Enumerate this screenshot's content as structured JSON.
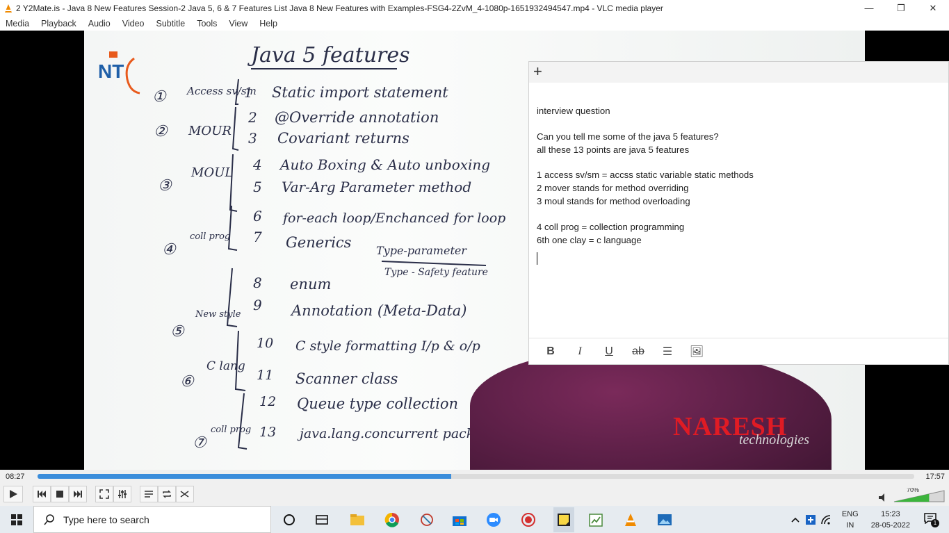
{
  "window": {
    "title": "2 Y2Mate.is - Java 8 New Features  Session-2  Java 5, 6 & 7 Features List  Java 8 New Features with Examples-FSG4-2ZvM_4-1080p-1651932494547.mp4 - VLC media player",
    "minimize": "—",
    "restore": "❐",
    "close": "✕"
  },
  "menu": [
    "Media",
    "Playback",
    "Audio",
    "Video",
    "Subtitle",
    "Tools",
    "View",
    "Help"
  ],
  "video": {
    "board_title": "Java 5 features",
    "logo_text": "NT",
    "brand_main": "NARESH",
    "brand_sub": "technologies",
    "groups": [
      {
        "num": "①",
        "label": "Access sv/sm"
      },
      {
        "num": "②",
        "label": "MOUR"
      },
      {
        "num": "③",
        "label": "MOUL"
      },
      {
        "num": "④",
        "label": "coll prog"
      },
      {
        "num": "⑤",
        "label": "New style"
      },
      {
        "num": "⑥",
        "label": "C lang"
      },
      {
        "num": "⑦",
        "label": "coll prog"
      }
    ],
    "items": [
      {
        "n": "1",
        "text": "Static import statement"
      },
      {
        "n": "2",
        "text": "@Override annotation"
      },
      {
        "n": "3",
        "text": "Covariant returns"
      },
      {
        "n": "4",
        "text": "Auto Boxing & Auto unboxing"
      },
      {
        "n": "5",
        "text": "Var-Arg Parameter method"
      },
      {
        "n": "6",
        "text": "for-each loop/Enchanced for loop"
      },
      {
        "n": "7",
        "text": "Generics"
      },
      {
        "n": "8",
        "text": "enum"
      },
      {
        "n": "9",
        "text": "Annotation (Meta-Data)"
      },
      {
        "n": "10",
        "text": "C style formatting I/p & o/p"
      },
      {
        "n": "11",
        "text": "Scanner class"
      },
      {
        "n": "12",
        "text": "Queue type collection"
      },
      {
        "n": "13",
        "text": "java.lang.concurrent package"
      }
    ],
    "generics_note_1": "Type-parameter",
    "generics_note_2": "Type - Safety feature"
  },
  "note": {
    "add": "+",
    "lines": [
      "interview question",
      "",
      "Can you tell me some of the java 5 features?",
      "all these 13 points are java 5 features",
      "",
      "1 access sv/sm =  accss static variable static methods",
      "2 mover stands for method overriding",
      "3 moul stands for method overloading",
      "",
      "4 coll prog = collection programming",
      "6th one clay = c language"
    ],
    "tools": {
      "bold": "B",
      "italic": "I",
      "underline": "U",
      "strike": "ab",
      "list": "☰",
      "image": "🖼"
    }
  },
  "player": {
    "current_time": "08:27",
    "total_time": "17:57",
    "progress": 0.472,
    "volume_label": "70%",
    "volume": 0.7
  },
  "taskbar": {
    "search_placeholder": "Type here to search",
    "lang_1": "ENG",
    "lang_2": "IN",
    "time": "15:23",
    "date": "28-05-2022",
    "notif_count": "1"
  }
}
